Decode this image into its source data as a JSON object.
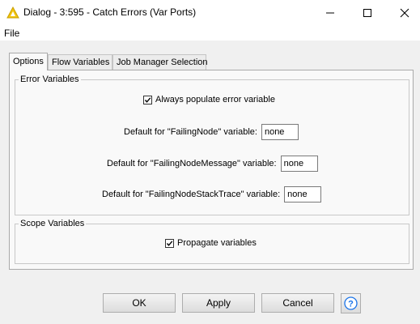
{
  "window": {
    "title": "Dialog - 3:595 - Catch Errors (Var Ports)",
    "app_icon": "knime-warning-triangle-icon",
    "controls": [
      "minimize-icon",
      "maximize-icon",
      "close-icon"
    ]
  },
  "menu": {
    "items": [
      "File"
    ]
  },
  "tabs": [
    {
      "label": "Options",
      "active": true
    },
    {
      "label": "Flow Variables",
      "active": false
    },
    {
      "label": "Job Manager Selection",
      "active": false
    }
  ],
  "error_variables": {
    "group_title": "Error Variables",
    "always_populate": {
      "label": "Always populate error variable",
      "checked": true
    },
    "fields": [
      {
        "label": "Default for \"FailingNode\" variable:",
        "value": "none"
      },
      {
        "label": "Default for \"FailingNodeMessage\" variable:",
        "value": "none"
      },
      {
        "label": "Default for \"FailingNodeStackTrace\" variable:",
        "value": "none"
      }
    ]
  },
  "scope_variables": {
    "group_title": "Scope Variables",
    "propagate": {
      "label": "Propagate variables",
      "checked": true
    }
  },
  "buttons": {
    "ok": "OK",
    "apply": "Apply",
    "cancel": "Cancel",
    "help_icon": "help-icon"
  },
  "colors": {
    "accent_blue": "#1a73e8",
    "knime_yellow": "#f2c40f"
  }
}
